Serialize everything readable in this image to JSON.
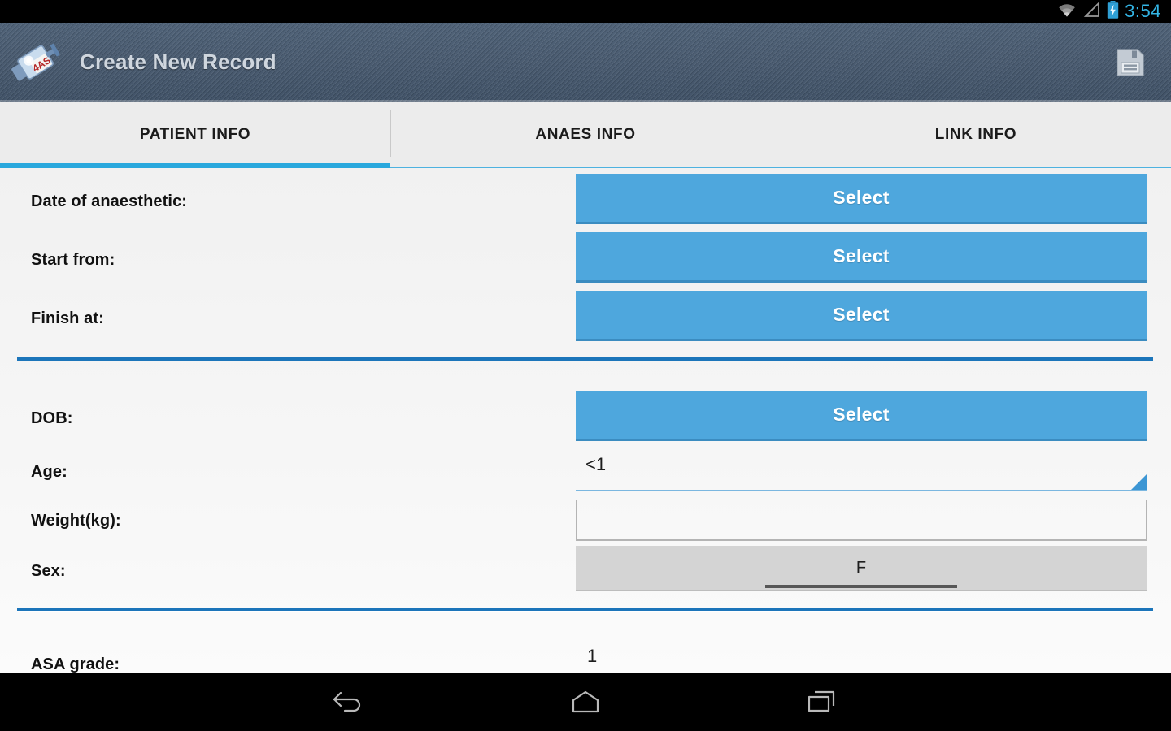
{
  "status_bar": {
    "wifi_icon": "wifi-icon",
    "signal_icon": "cell-signal-icon",
    "battery_icon": "battery-charging-icon",
    "time": "3:54"
  },
  "action_bar": {
    "logo_icon": "app-logo-syringe-icon",
    "logo_text": "4AS",
    "title": "Create New Record",
    "save_icon": "save-floppy-icon"
  },
  "tabs": [
    {
      "label": "PATIENT INFO",
      "active": true
    },
    {
      "label": "ANAES INFO",
      "active": false
    },
    {
      "label": "LINK INFO",
      "active": false
    }
  ],
  "form": {
    "date_of_anaesthetic": {
      "label": "Date of anaesthetic:",
      "button": "Select"
    },
    "start_from": {
      "label": "Start from:",
      "button": "Select"
    },
    "finish_at": {
      "label": "Finish at:",
      "button": "Select"
    },
    "dob": {
      "label": "DOB:",
      "button": "Select"
    },
    "age": {
      "label": "Age:",
      "value": "<1"
    },
    "weight": {
      "label": "Weight(kg):",
      "value": ""
    },
    "sex": {
      "label": "Sex:",
      "value": "F"
    },
    "asa_grade": {
      "label": "ASA grade:",
      "value": "1"
    }
  },
  "nav_bar": {
    "back_icon": "back-arrow-icon",
    "home_icon": "home-icon",
    "recents_icon": "recent-apps-icon"
  },
  "colors": {
    "accent_blue": "#4ea7dd",
    "divider_blue": "#1c75ba",
    "tab_underline": "#29a8dd",
    "status_text": "#33b5e5",
    "action_bar": "#47596e"
  }
}
